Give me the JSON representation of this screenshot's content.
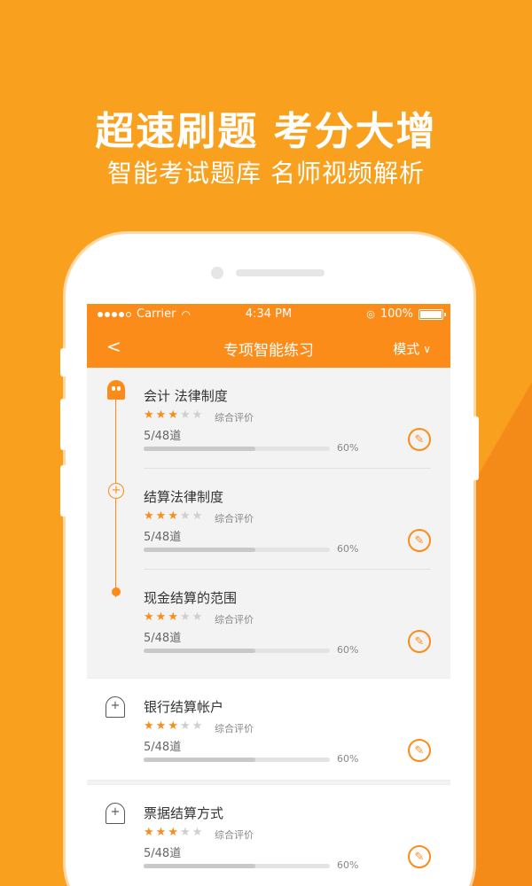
{
  "promo": {
    "headline": "超速刷题 考分大增",
    "subline": "智能考试题库 名师视频解析"
  },
  "statusbar": {
    "carrier": "Carrier",
    "time": "4:34 PM",
    "battery": "100%"
  },
  "navbar": {
    "back": "<",
    "title": "专项智能练习",
    "mode": "模式"
  },
  "rating_label": "综合评价",
  "items": [
    {
      "title": "会计 法律制度",
      "stars_on": 3,
      "stars_total": 5,
      "count": "5/48道",
      "progress": 0.6,
      "pct": "60%"
    },
    {
      "title": "结算法律制度",
      "stars_on": 3,
      "stars_total": 5,
      "count": "5/48道",
      "progress": 0.6,
      "pct": "60%"
    },
    {
      "title": "现金结算的范围",
      "stars_on": 3,
      "stars_total": 5,
      "count": "5/48道",
      "progress": 0.6,
      "pct": "60%"
    }
  ],
  "cards": [
    {
      "title": "银行结算帐户",
      "stars_on": 3,
      "stars_total": 5,
      "count": "5/48道",
      "progress": 0.6,
      "pct": "60%"
    },
    {
      "title": "票据结算方式",
      "stars_on": 3,
      "stars_total": 5,
      "count": "5/48道",
      "progress": 0.6,
      "pct": "60%"
    }
  ],
  "colors": {
    "accent": "#FB8C1A",
    "background": "#F9A11E"
  }
}
